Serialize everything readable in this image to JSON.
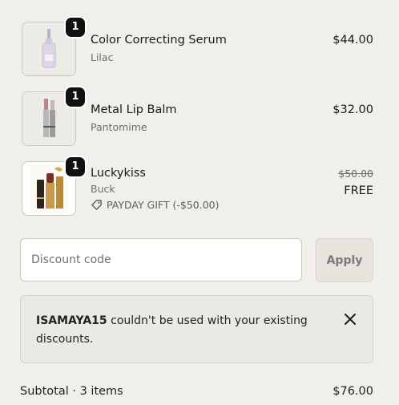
{
  "items": [
    {
      "name": "Color Correcting Serum",
      "variant": "Lilac",
      "price": "$44.00",
      "quantity": "1",
      "image": "serum-bottle-icon"
    },
    {
      "name": "Metal Lip Balm",
      "variant": "Pantomime",
      "price": "$32.00",
      "quantity": "1",
      "image": "lip-balm-icon"
    },
    {
      "name": "Luckykiss",
      "variant": "Buck",
      "old_price": "$50.00",
      "price": "FREE",
      "quantity": "1",
      "gift_label": "PAYDAY GIFT (-$50.00)",
      "image": "lipstick-icon"
    }
  ],
  "discount": {
    "placeholder": "Discount code",
    "apply_label": "Apply"
  },
  "notice": {
    "code": "ISAMAYA15",
    "message": "couldn't be used with your existing discounts."
  },
  "summary": {
    "label": "Subtotal · 3 items",
    "value": "$76.00"
  },
  "colors": {
    "background": "#f1efea",
    "badge": "#111111",
    "notice_bg": "#ebe9e3"
  }
}
